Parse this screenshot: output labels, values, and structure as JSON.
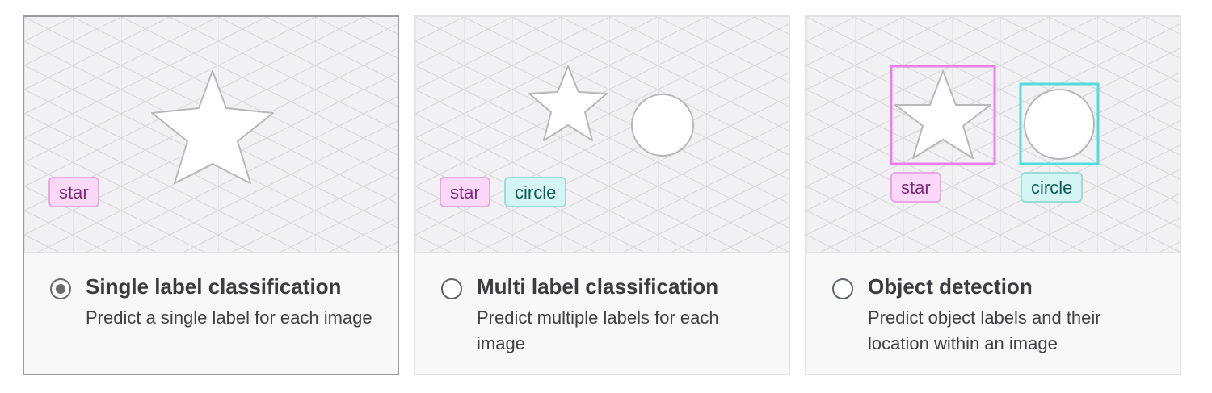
{
  "colors": {
    "star_chip_bg": "#fbd7f8",
    "circle_chip_bg": "#d4f5f3",
    "star_box": "#ee7ef0",
    "circle_box": "#52dcdc",
    "selected_border": "#9a9aa0"
  },
  "options": [
    {
      "id": "single",
      "title": "Single label classification",
      "description": "Predict a single label for each image",
      "selected": true,
      "labels": [
        "star"
      ]
    },
    {
      "id": "multi",
      "title": "Multi label classification",
      "description": "Predict multiple labels for each image",
      "selected": false,
      "labels": [
        "star",
        "circle"
      ]
    },
    {
      "id": "detection",
      "title": "Object detection",
      "description": "Predict object labels and their location within an image",
      "selected": false,
      "labels": [
        "star",
        "circle"
      ]
    }
  ]
}
